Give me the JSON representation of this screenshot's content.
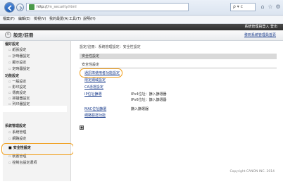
{
  "browser": {
    "address_prefix": "http://",
    "address_host_hidden": "",
    "address_path": "/m_security.html",
    "search_placeholder": "ρ ▾ c",
    "menus": [
      "檔案(F)",
      "編輯(E)",
      "檢視(V)",
      "我的最愛(A)",
      "工具(T)",
      "說明(H)"
    ]
  },
  "app": {
    "top_links": "系統管理員登入 登出",
    "title": "設定/註冊",
    "top_right_link": "移到系統管理員首頁"
  },
  "sidebar": {
    "sections": [
      {
        "label": "偏好設定",
        "items": [
          "紙張設定",
          "計時器設定",
          "顯示設定",
          "定時器設定"
        ]
      },
      {
        "label": "功能設定",
        "items": [
          "一般設定",
          "影印設定",
          "傳真設定",
          "掃描器設定",
          "列印器設定"
        ]
      },
      {
        "label": "系統管理設定",
        "items": [
          "系統管理",
          "網路設定",
          "安全性設定",
          "裝置管理",
          "控制台設定選項"
        ]
      }
    ],
    "selected_item": "安全性設定"
  },
  "main": {
    "breadcrumb": "設定/註冊：系統管理設定：安全性設定",
    "section_header": "安全性設定",
    "subsection_header": "安全性設定",
    "links": [
      {
        "label": "通訊埠使用者功能設定",
        "value": ""
      },
      {
        "label": "限定網域設定",
        "value": ""
      },
      {
        "label": "CA憑證設定",
        "value": ""
      },
      {
        "label": "IP位址篩選",
        "value": "IPv4位址：篩入篩選器"
      },
      {
        "label": "",
        "value": "IPv6位址：篩入篩選器"
      },
      {
        "label": "MAC位址篩選",
        "value": "篩入篩選器"
      },
      {
        "label": "網路驗證功能",
        "value": ""
      }
    ],
    "top_icon_glyph": "■",
    "copyright": "Copyright CANON INC. 2014"
  }
}
